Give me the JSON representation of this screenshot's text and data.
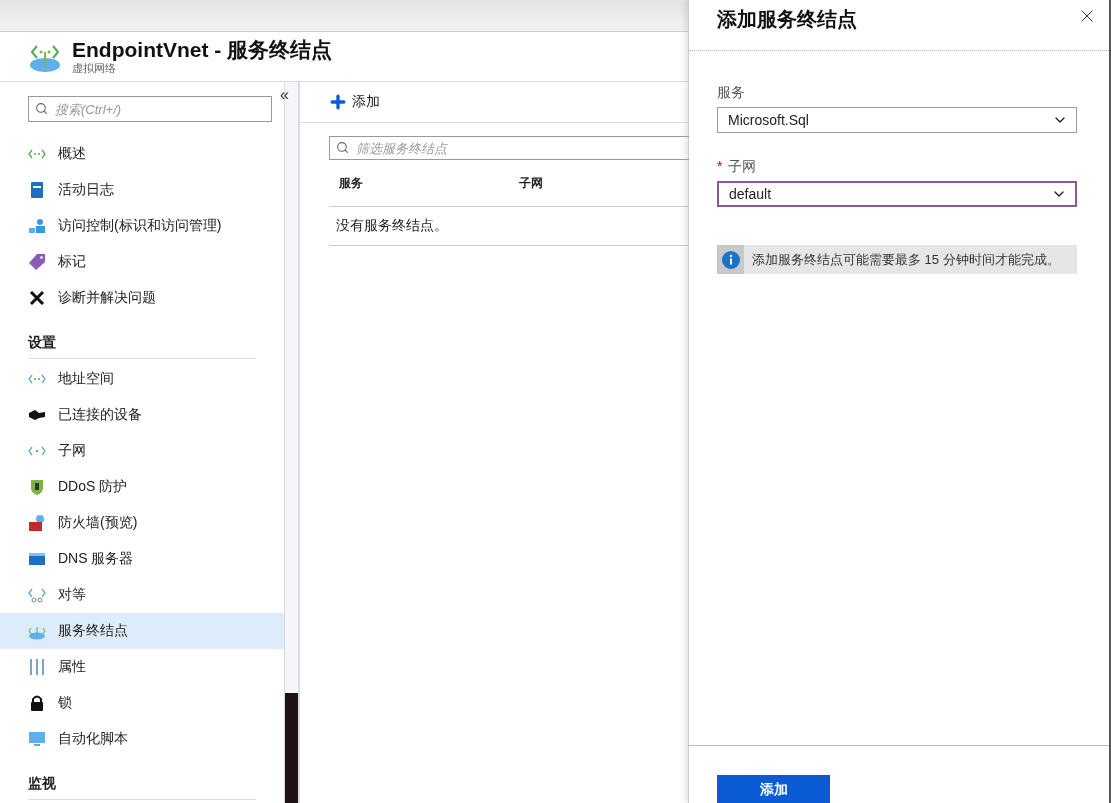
{
  "blade": {
    "title": "EndpointVnet - 服务终结点",
    "subtitle": "虚拟网络"
  },
  "sidebar": {
    "collapse_glyph": "«",
    "search": {
      "placeholder": "搜索(Ctrl+/)"
    },
    "items": [
      {
        "kind": "item",
        "label": "概述",
        "selected": false
      },
      {
        "kind": "item",
        "label": "活动日志",
        "selected": false
      },
      {
        "kind": "item",
        "label": "访问控制(标识和访问管理)",
        "selected": false
      },
      {
        "kind": "item",
        "label": "标记",
        "selected": false
      },
      {
        "kind": "item",
        "label": "诊断并解决问题",
        "selected": false
      },
      {
        "kind": "section",
        "label": "设置"
      },
      {
        "kind": "item",
        "label": "地址空间",
        "selected": false
      },
      {
        "kind": "item",
        "label": "已连接的设备",
        "selected": false
      },
      {
        "kind": "item",
        "label": "子网",
        "selected": false
      },
      {
        "kind": "item",
        "label": "DDoS 防护",
        "selected": false
      },
      {
        "kind": "item",
        "label": "防火墙(预览)",
        "selected": false
      },
      {
        "kind": "item",
        "label": "DNS 服务器",
        "selected": false
      },
      {
        "kind": "item",
        "label": "对等",
        "selected": false
      },
      {
        "kind": "item",
        "label": "服务终结点",
        "selected": true
      },
      {
        "kind": "item",
        "label": "属性",
        "selected": false
      },
      {
        "kind": "item",
        "label": "锁",
        "selected": false
      },
      {
        "kind": "item",
        "label": "自动化脚本",
        "selected": false
      },
      {
        "kind": "section",
        "label": "监视"
      }
    ]
  },
  "toolbar": {
    "add_label": "添加"
  },
  "filter": {
    "placeholder": "筛选服务终结点"
  },
  "table": {
    "columns": [
      "服务",
      "子网"
    ],
    "empty_text": "没有服务终结点。"
  },
  "panel": {
    "title": "添加服务终结点",
    "fields": [
      {
        "label": "服务",
        "value": "Microsoft.Sql",
        "focused": false
      },
      {
        "label": "子网",
        "marker": "*",
        "value": "default",
        "focused": true
      }
    ],
    "info": "添加服务终结点可能需要最多 15 分钟时间才能完成。",
    "submit": "添加"
  }
}
